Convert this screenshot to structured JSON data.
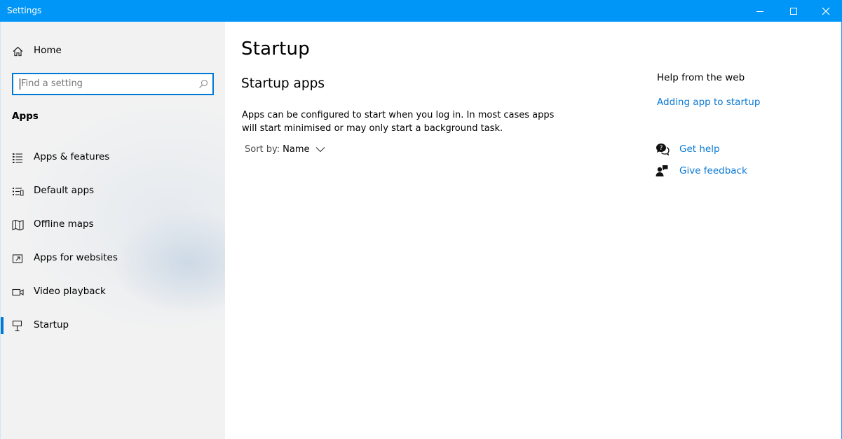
{
  "window": {
    "title": "Settings"
  },
  "sidebar": {
    "home_label": "Home",
    "search_placeholder": "Find a setting",
    "section_label": "Apps",
    "items": [
      {
        "label": "Apps & features",
        "icon": "list-icon"
      },
      {
        "label": "Default apps",
        "icon": "default-apps-icon"
      },
      {
        "label": "Offline maps",
        "icon": "map-icon"
      },
      {
        "label": "Apps for websites",
        "icon": "open-link-icon"
      },
      {
        "label": "Video playback",
        "icon": "video-camera-icon"
      },
      {
        "label": "Startup",
        "icon": "startup-icon",
        "selected": true
      }
    ]
  },
  "main": {
    "title": "Startup",
    "subtitle": "Startup apps",
    "description": "Apps can be configured to start when you log in. In most cases apps will start minimised or may only start a background task.",
    "sort_label": "Sort by:",
    "sort_value": "Name"
  },
  "help": {
    "heading": "Help from the web",
    "link": "Adding app to startup",
    "get_help": "Get help",
    "give_feedback": "Give feedback"
  },
  "colors": {
    "titlebar": "#0096f7",
    "accent": "#0078d7",
    "link": "#0a78d4",
    "sidebar_bg": "#f2f2f2"
  }
}
